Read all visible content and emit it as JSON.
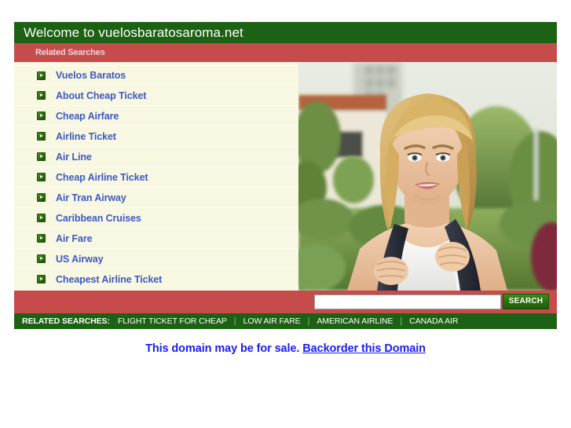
{
  "header": {
    "title": "Welcome to vuelosbaratosaroma.net",
    "bg_color": "#1d6114",
    "text_color": "#ffffff"
  },
  "related_strip": {
    "label": "Related Searches",
    "bg_color": "#c64c4c"
  },
  "links": [
    {
      "label": "Vuelos Baratos",
      "icon": "arrow-right-icon"
    },
    {
      "label": "About Cheap Ticket",
      "icon": "arrow-right-icon"
    },
    {
      "label": "Cheap Airfare",
      "icon": "arrow-right-icon"
    },
    {
      "label": "Airline Ticket",
      "icon": "arrow-right-icon"
    },
    {
      "label": "Air Line",
      "icon": "arrow-right-icon"
    },
    {
      "label": "Cheap Airline Ticket",
      "icon": "arrow-right-icon"
    },
    {
      "label": "Air Tran Airway",
      "icon": "arrow-right-icon"
    },
    {
      "label": "Caribbean Cruises",
      "icon": "arrow-right-icon"
    },
    {
      "label": "Air Fare",
      "icon": "arrow-right-icon"
    },
    {
      "label": "US Airway",
      "icon": "arrow-right-icon"
    },
    {
      "label": "Cheapest Airline Ticket",
      "icon": "arrow-right-icon"
    }
  ],
  "link_style": {
    "text_color": "#3e59c4",
    "list_bg_color": "#f7f7e2"
  },
  "photo": {
    "alt": "Smiling blonde young woman wearing a backpack outdoors in front of a building with trees"
  },
  "search": {
    "value": "",
    "placeholder": "",
    "button_label": "SEARCH",
    "button_color": "#2d7210",
    "bar_color": "#c64c4c"
  },
  "footer_searches": {
    "label": "RELATED SEARCHES:",
    "separator": "|",
    "items": [
      "FLIGHT TICKET FOR CHEAP",
      "LOW AIR FARE",
      "AMERICAN AIRLINE",
      "CANADA AIR"
    ],
    "bg_color": "#1d6114"
  },
  "notice": {
    "text": "This domain may be for sale.",
    "link_label": "Backorder this Domain",
    "color": "#1a20ef"
  }
}
